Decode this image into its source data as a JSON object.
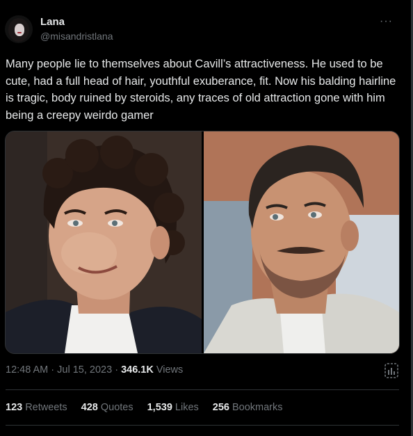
{
  "author": {
    "display_name": "Lana",
    "handle": "@misandristlana"
  },
  "tweet": {
    "text": "Many people lie to themselves about Cavill’s attractiveness. He used to be cute, had a full head of hair, youthful exuberance, fit. Now his balding hairline is tragic, body ruined by steroids, any traces of old attraction gone with him being a creepy weirdo gamer",
    "more_icon": "···"
  },
  "media": {
    "left_image": "photo-curly-hair-man",
    "right_image": "photo-slicked-hair-man-mustache"
  },
  "meta": {
    "time": "12:48 AM",
    "date": "Jul 15, 2023",
    "separator": " · ",
    "views_count": "346.1K",
    "views_label": "Views"
  },
  "stats": [
    {
      "count": "123",
      "label": "Retweets"
    },
    {
      "count": "428",
      "label": "Quotes"
    },
    {
      "count": "1,539",
      "label": "Likes"
    },
    {
      "count": "256",
      "label": "Bookmarks"
    }
  ],
  "colors": {
    "background": "#000000",
    "text": "#e7e9ea",
    "muted": "#71767b",
    "border": "#2f3336"
  }
}
